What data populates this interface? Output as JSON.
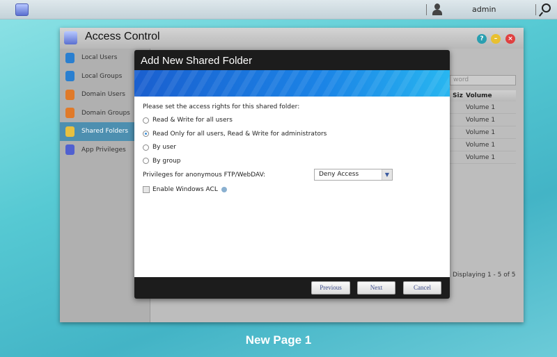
{
  "topbar": {
    "user": "admin"
  },
  "window": {
    "title": "Access Control"
  },
  "sidebar": {
    "items": [
      {
        "label": "Local Users",
        "color": "#2a7fd0"
      },
      {
        "label": "Local Groups",
        "color": "#2a7fd0"
      },
      {
        "label": "Domain Users",
        "color": "#e07a2a"
      },
      {
        "label": "Domain Groups",
        "color": "#e07a2a"
      },
      {
        "label": "Shared Folders",
        "color": "#e8c040",
        "selected": true
      },
      {
        "label": "App Privileges",
        "color": "#5060d0"
      }
    ]
  },
  "background_table": {
    "search_placeholder": "word",
    "columns": [
      "Siz",
      "Volume"
    ],
    "rows": [
      "Volume 1",
      "Volume 1",
      "Volume 1",
      "Volume 1",
      "Volume 1"
    ],
    "status": "Displaying 1 - 5 of 5"
  },
  "dialog": {
    "title": "Add New Shared Folder",
    "prompt": "Please set the access rights for this shared folder:",
    "options": [
      {
        "label": "Read & Write for all users",
        "checked": false
      },
      {
        "label": "Read Only for all users, Read & Write for administrators",
        "checked": true
      },
      {
        "label": "By user",
        "checked": false
      },
      {
        "label": "By group",
        "checked": false
      }
    ],
    "anon_label": "Privileges for anonymous FTP/WebDAV:",
    "anon_value": "Deny Access",
    "acl_label": "Enable Windows ACL",
    "acl_checked": false,
    "buttons": {
      "previous": "Previous",
      "next": "Next",
      "cancel": "Cancel"
    }
  },
  "caption": "New Page 1"
}
